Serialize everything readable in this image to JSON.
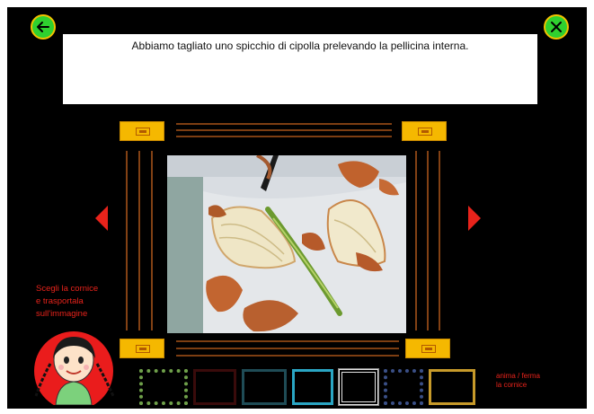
{
  "caption": {
    "text": "Abbiamo tagliato uno spicchio di cipolla prelevando la pellicina interna."
  },
  "toolbar": {
    "back_icon": "arrow-left-icon",
    "close_icon": "close-icon"
  },
  "instructions": {
    "line1": "Scegli la cornice",
    "line2": "e trasportala",
    "line3": "sull'immagine"
  },
  "animation": {
    "line1": "anima / ferma",
    "line2": "la cornice"
  },
  "colors": {
    "background": "#000000",
    "button_green": "#2fd12f",
    "handle_yellow": "#f5b800",
    "frame_orange": "#c8641e",
    "arrow_red": "#e8231b"
  },
  "frame_thumbnails": [
    {
      "icon": "frame-green-dots-icon",
      "color": "#6fa04a"
    },
    {
      "icon": "frame-dark-red-icon",
      "color": "#3a0b0b"
    },
    {
      "icon": "frame-dark-teal-icon",
      "color": "#1f4c56"
    },
    {
      "icon": "frame-cyan-icon",
      "color": "#2aa6c4"
    },
    {
      "icon": "frame-white-ornate-icon",
      "color": "#e6e6e6"
    },
    {
      "icon": "frame-dark-blue-dots-icon",
      "color": "#3a4f86"
    },
    {
      "icon": "frame-gold-icon",
      "color": "#c79a2a"
    }
  ]
}
